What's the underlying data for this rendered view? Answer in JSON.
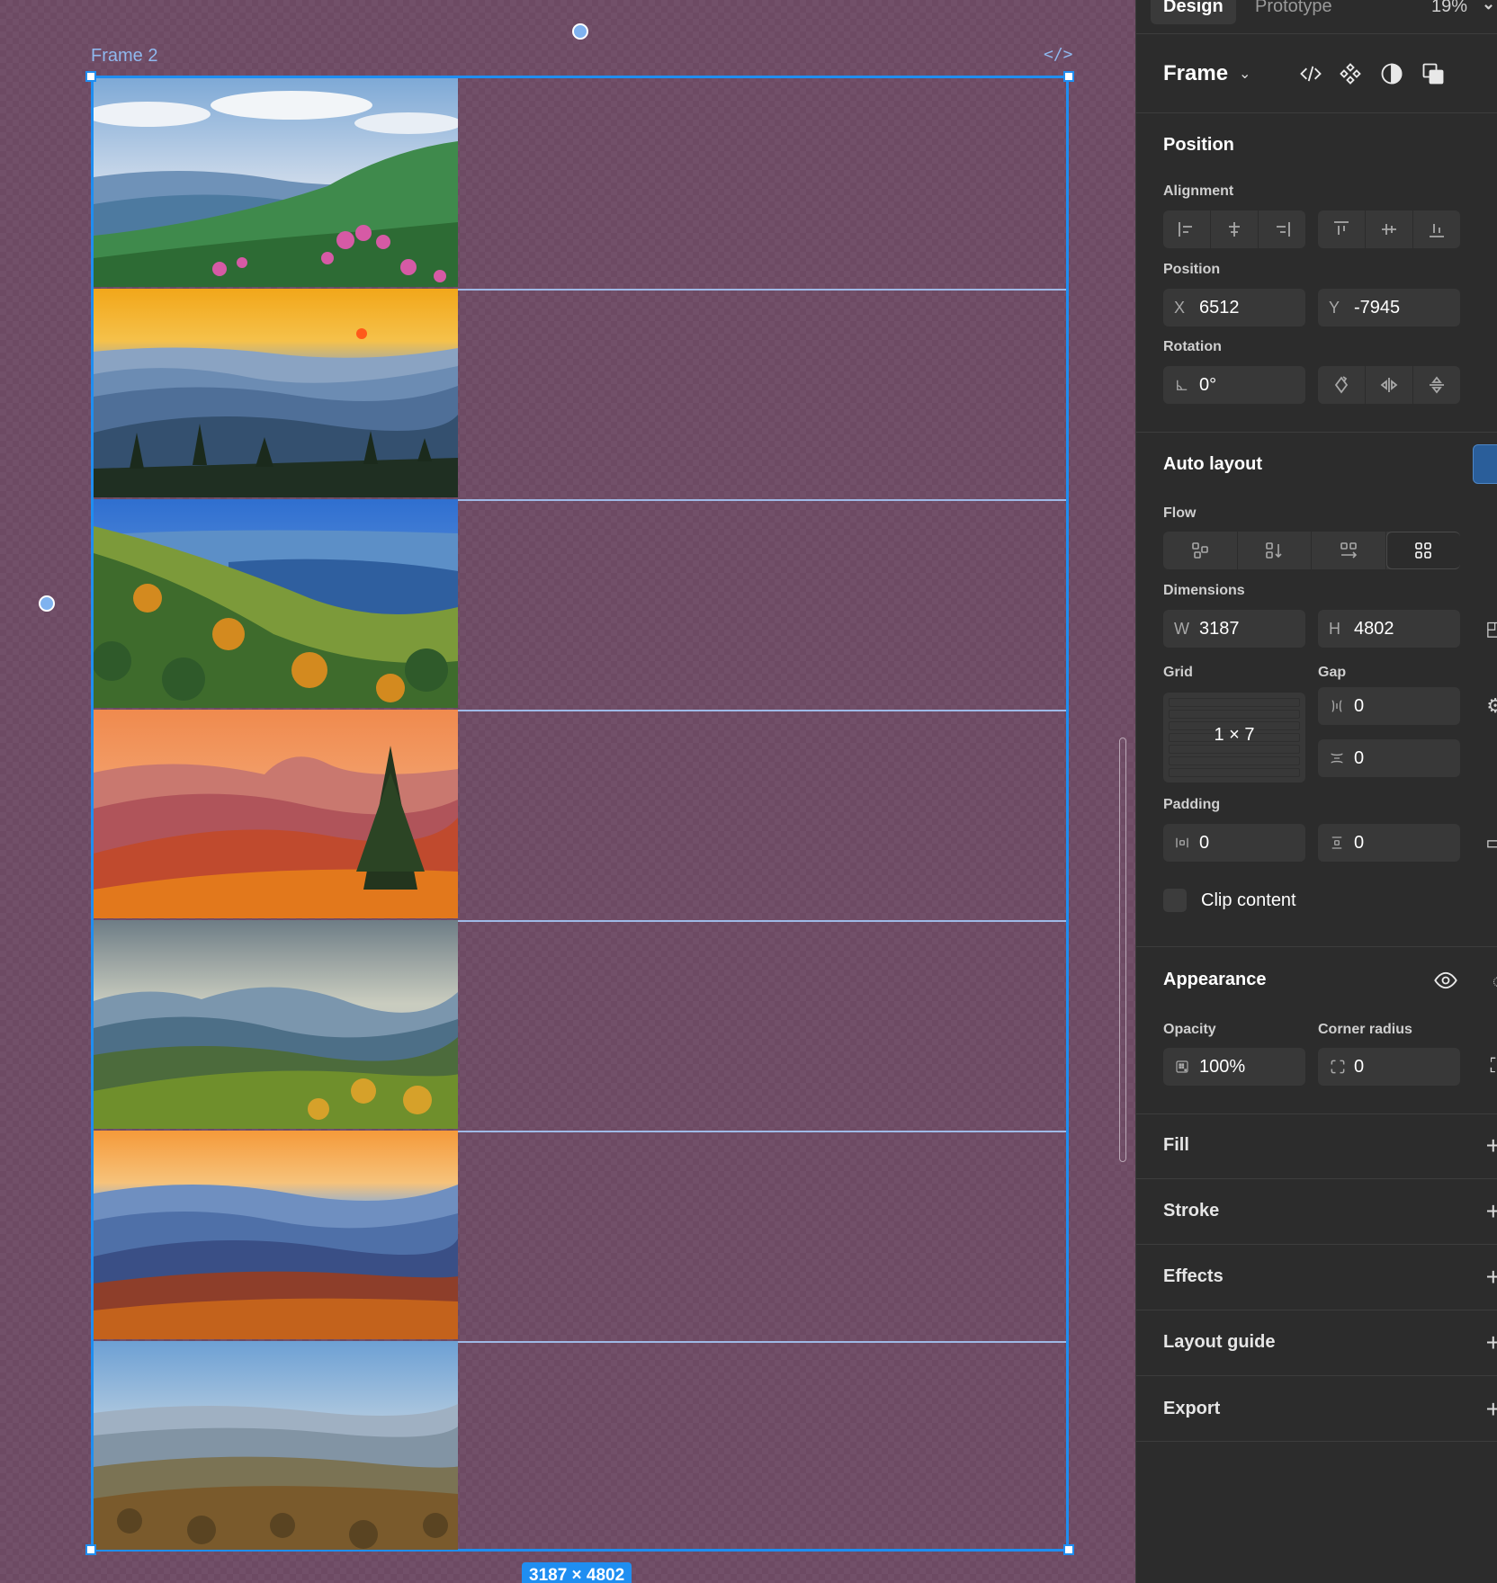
{
  "canvas": {
    "frame_label": "Frame 2",
    "code_badge": "</>",
    "size_tag": "3187 × 4802",
    "photos": [
      {
        "name": "green-mountains-rhododendron"
      },
      {
        "name": "blue-ridge-sunset"
      },
      {
        "name": "autumn-valley-blue-sky"
      },
      {
        "name": "orange-sunset-pine"
      },
      {
        "name": "cloudy-green-ridges"
      },
      {
        "name": "orange-sky-blue-ridges"
      },
      {
        "name": "hazy-autumn-hills"
      }
    ]
  },
  "panel": {
    "tabs": {
      "design": "Design",
      "prototype": "Prototype",
      "zoom": "19%",
      "chevron": "⌄"
    },
    "header": {
      "title": "Frame",
      "chevron": "⌄",
      "icons": [
        "code-icon",
        "component-icon",
        "mask-icon",
        "boolean-icon"
      ]
    },
    "position": {
      "title": "Position",
      "alignment_label": "Alignment",
      "position_label": "Position",
      "x_prefix": "X",
      "x_value": "6512",
      "y_prefix": "Y",
      "y_value": "-7945",
      "rotation_label": "Rotation",
      "rotation_value": "0°"
    },
    "auto_layout": {
      "title": "Auto layout",
      "flow_label": "Flow",
      "dimensions_label": "Dimensions",
      "w_prefix": "W",
      "w_value": "3187",
      "h_prefix": "H",
      "h_value": "4802",
      "grid_label": "Grid",
      "grid_value": "1 × 7",
      "gap_label": "Gap",
      "gap_col_value": "0",
      "gap_row_value": "0",
      "padding_label": "Padding",
      "padding_h_value": "0",
      "padding_v_value": "0",
      "clip_label": "Clip content"
    },
    "appearance": {
      "title": "Appearance",
      "opacity_label": "Opacity",
      "opacity_value": "100%",
      "radius_label": "Corner radius",
      "radius_value": "0"
    },
    "sections": [
      "Fill",
      "Stroke",
      "Effects",
      "Layout guide",
      "Export"
    ],
    "plus": "+"
  }
}
